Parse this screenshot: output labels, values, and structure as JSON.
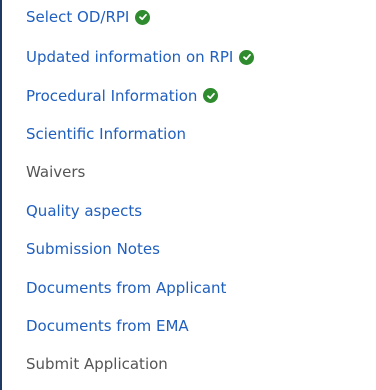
{
  "nav": {
    "items": [
      {
        "label": "Select OD/RPI",
        "completed": true,
        "style": "link"
      },
      {
        "label": "Updated information on RPI",
        "completed": true,
        "style": "link"
      },
      {
        "label": "Procedural Information",
        "completed": true,
        "style": "link"
      },
      {
        "label": "Scientific Information",
        "completed": false,
        "style": "link"
      },
      {
        "label": "Waivers",
        "completed": false,
        "style": "plain"
      },
      {
        "label": "Quality aspects",
        "completed": false,
        "style": "link"
      },
      {
        "label": "Submission Notes",
        "completed": false,
        "style": "link"
      },
      {
        "label": "Documents from Applicant",
        "completed": false,
        "style": "link"
      },
      {
        "label": "Documents from EMA",
        "completed": false,
        "style": "link"
      },
      {
        "label": "Submit Application",
        "completed": false,
        "style": "plain"
      }
    ],
    "icon": "check-circle-icon",
    "colors": {
      "link": "#1f5fbf",
      "plain": "#555555",
      "check": "#2e8b2e",
      "border": "#1f3864"
    }
  }
}
